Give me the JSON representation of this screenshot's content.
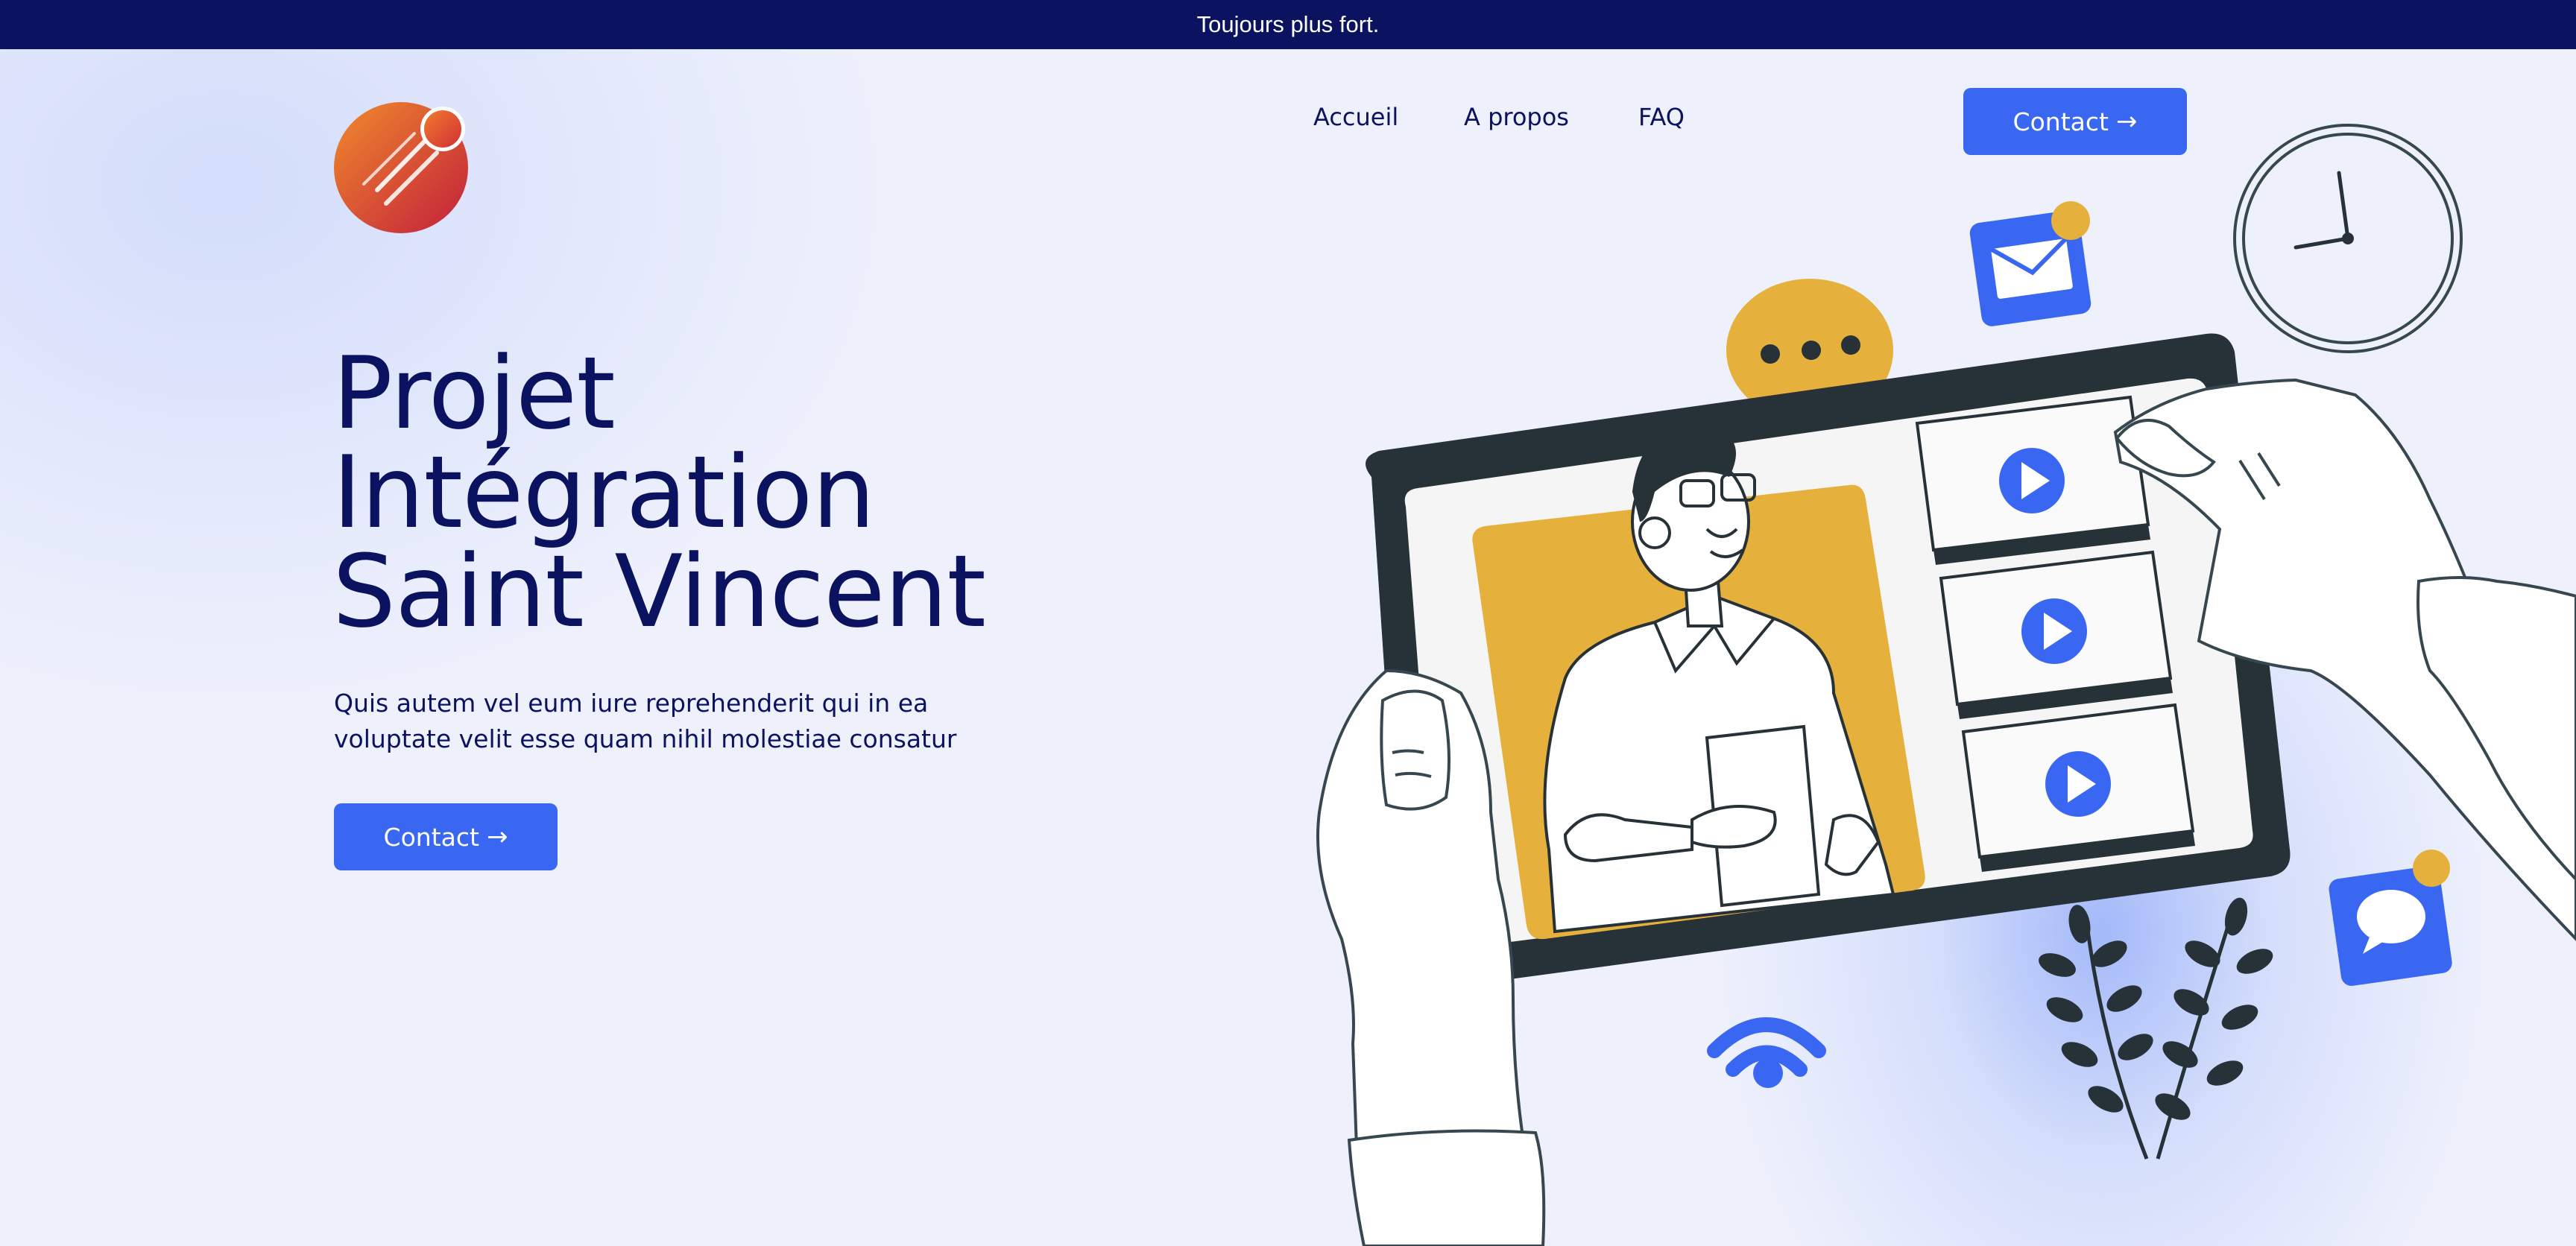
{
  "announcement": {
    "text": "Toujours plus fort."
  },
  "brand": {
    "logo_icon": "comet-logo-icon",
    "colors": {
      "logo_gradient_start": "#ee7a2a",
      "logo_gradient_end": "#c4233a"
    }
  },
  "nav": {
    "items": [
      {
        "label": "Accueil"
      },
      {
        "label": "A propos"
      },
      {
        "label": "FAQ"
      }
    ],
    "contact_label": "Contact"
  },
  "hero": {
    "title_lines": [
      "Projet",
      "Intégration",
      "Saint Vincent"
    ],
    "description": "Quis autem vel eum iure reprehenderit qui in ea voluptate velit esse quam nihil molestiae consatur",
    "cta_label": "Contact",
    "cta_icon": "arrow-right-icon"
  },
  "illustration": {
    "icons": [
      "tablet-icon",
      "video-play-icon",
      "chat-bubble-icon",
      "mail-icon",
      "clock-icon",
      "wifi-icon",
      "plant-icon",
      "message-icon"
    ]
  },
  "colors": {
    "topbar": "#0b1360",
    "primary": "#3a67f2",
    "text_dark": "#0b1360",
    "accent_yellow": "#e6b03c",
    "tablet_frame": "#263238",
    "background": "#eef1fc"
  }
}
